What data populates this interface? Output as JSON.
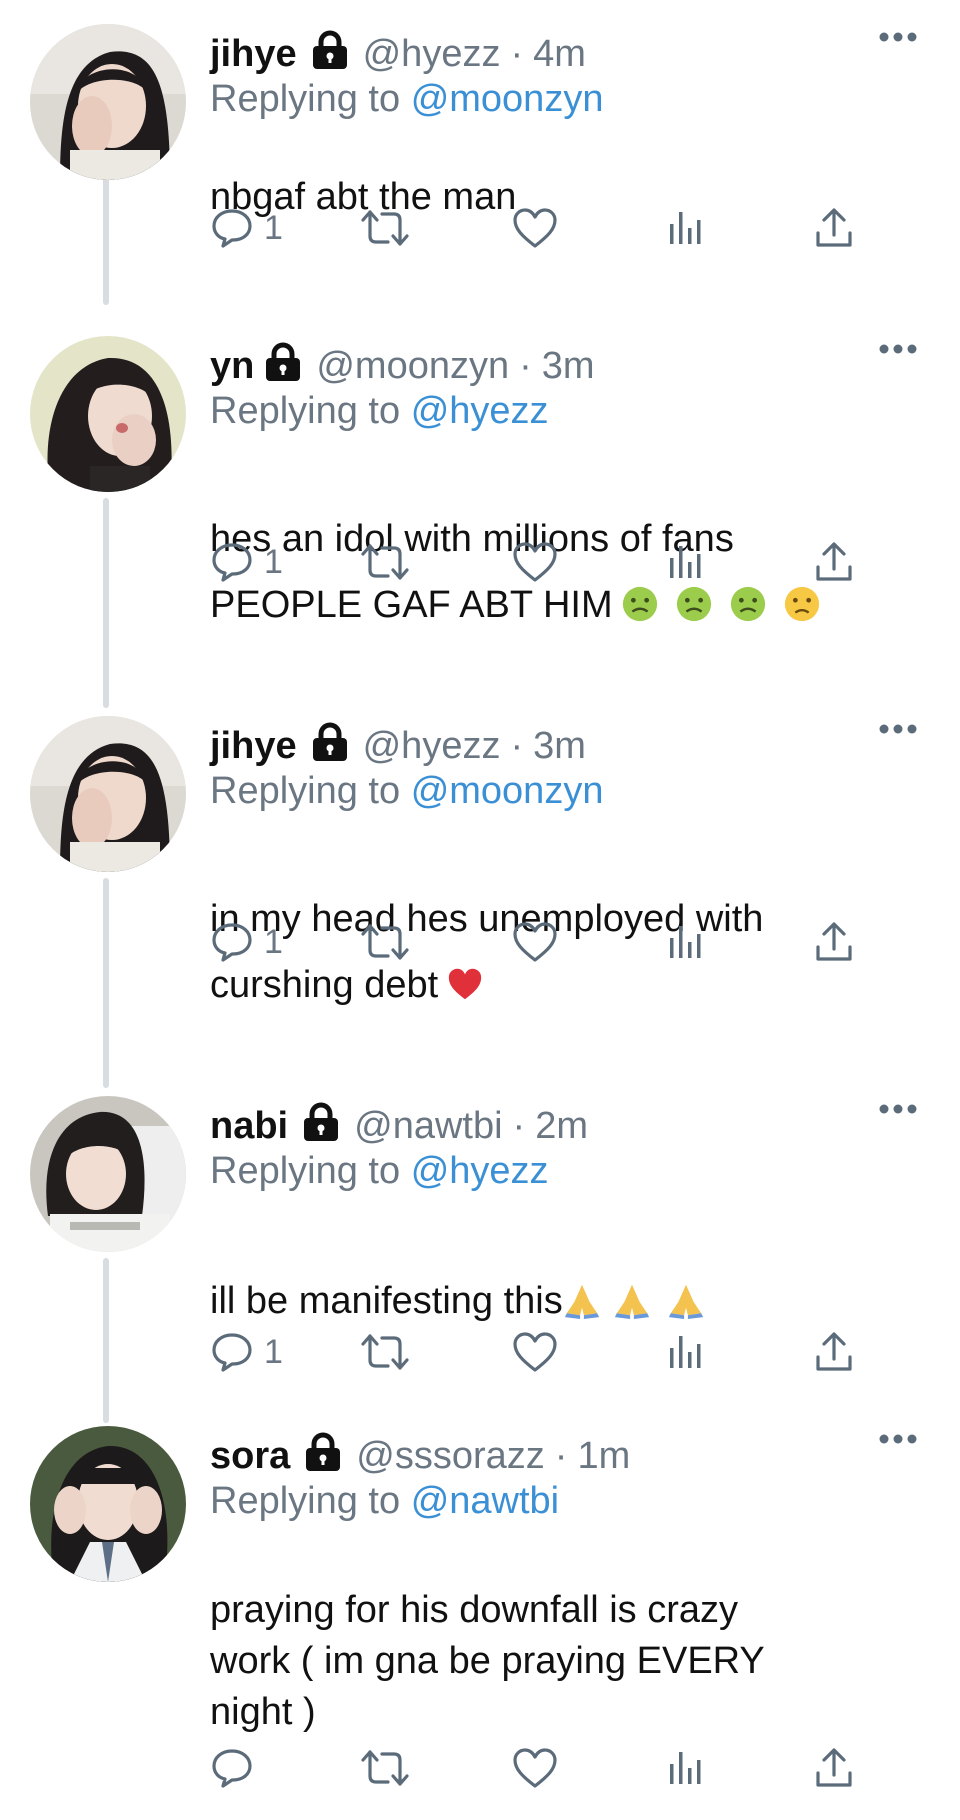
{
  "colors": {
    "text": "#111111",
    "secondary": "#6a7682",
    "link": "#3b90d5",
    "line": "#d8dde1",
    "icon": "#5b6b7a"
  },
  "tweets": [
    {
      "name": "jihye",
      "handle": "@hyezz",
      "sep": "·",
      "time": "4m",
      "reply_prefix": "Replying to",
      "reply_to": "@moonzyn",
      "text": "nbgaf abt the man",
      "reply_count": "1",
      "avatar": "avatar-jihye"
    },
    {
      "name": "yn",
      "handle": "@moonzyn",
      "sep": "·",
      "time": "3m",
      "reply_prefix": "Replying to",
      "reply_to": "@hyezz",
      "text": "hes an idol with millions of fans\nPEOPLE GAF ABT HIM",
      "reply_count": "1",
      "avatar": "avatar-yn",
      "emojis": [
        "nauseated-face",
        "nauseated-face",
        "nauseated-face",
        "slightly-frowning-face"
      ]
    },
    {
      "name": "jihye",
      "handle": "@hyezz",
      "sep": "·",
      "time": "3m",
      "reply_prefix": "Replying to",
      "reply_to": "@moonzyn",
      "text": "in my head hes unemployed with\ncurshing debt",
      "reply_count": "1",
      "avatar": "avatar-jihye",
      "emojis": [
        "red-heart"
      ]
    },
    {
      "name": "nabi",
      "handle": "@nawtbi",
      "sep": "·",
      "time": "2m",
      "reply_prefix": "Replying to",
      "reply_to": "@hyezz",
      "text": "ill be manifesting this",
      "reply_count": "1",
      "avatar": "avatar-nabi",
      "emojis": [
        "folded-hands",
        "folded-hands",
        "folded-hands"
      ]
    },
    {
      "name": "sora",
      "handle": "@sssorazz",
      "sep": "·",
      "time": "1m",
      "reply_prefix": "Replying to",
      "reply_to": "@nawtbi",
      "text": "praying for his downfall is crazy\nwork ( im gna be praying EVERY\nnight )",
      "reply_count": "",
      "avatar": "avatar-sora"
    }
  ],
  "icons": {
    "reply": "reply-icon",
    "retweet": "retweet-icon",
    "like": "heart-icon",
    "views": "views-icon",
    "share": "share-icon",
    "lock": "lock-icon",
    "more": "more-icon"
  }
}
